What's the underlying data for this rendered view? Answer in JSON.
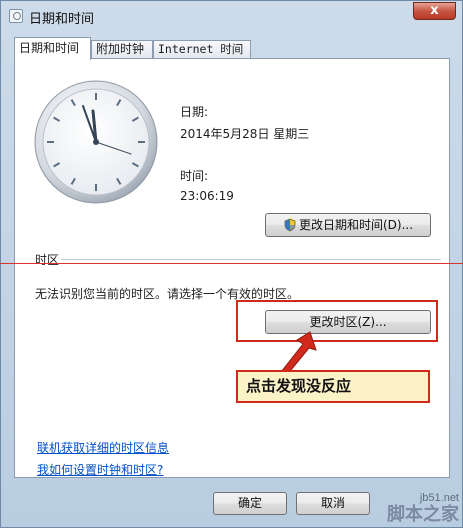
{
  "window": {
    "title": "日期和时间",
    "close_glyph": "x"
  },
  "tabs": [
    {
      "label": "日期和时间",
      "active": true
    },
    {
      "label": "附加时钟",
      "active": false
    },
    {
      "label": "Internet 时间",
      "active": false
    }
  ],
  "datetime": {
    "date_label": "日期:",
    "date_value": "2014年5月28日 星期三",
    "time_label": "时间:",
    "time_value": "23:06:19",
    "change_button": "更改日期和时间(D)..."
  },
  "timezone": {
    "section_title": "时区",
    "message": "无法识别您当前的时区。请选择一个有效的时区。",
    "change_button": "更改时区(Z)..."
  },
  "annotation": {
    "callout_text": "点击发现没反应",
    "color": "#d12a1d"
  },
  "links": [
    {
      "label": "联机获取详细的时区信息"
    },
    {
      "label": "我如何设置时钟和时区?"
    }
  ],
  "footer": {
    "ok": "确定",
    "cancel": "取消"
  },
  "watermark": {
    "site": "jb51.net",
    "brand": "脚本之家"
  },
  "icons": [
    "clock-icon",
    "shield-icon",
    "close-icon",
    "arrow-icon"
  ]
}
